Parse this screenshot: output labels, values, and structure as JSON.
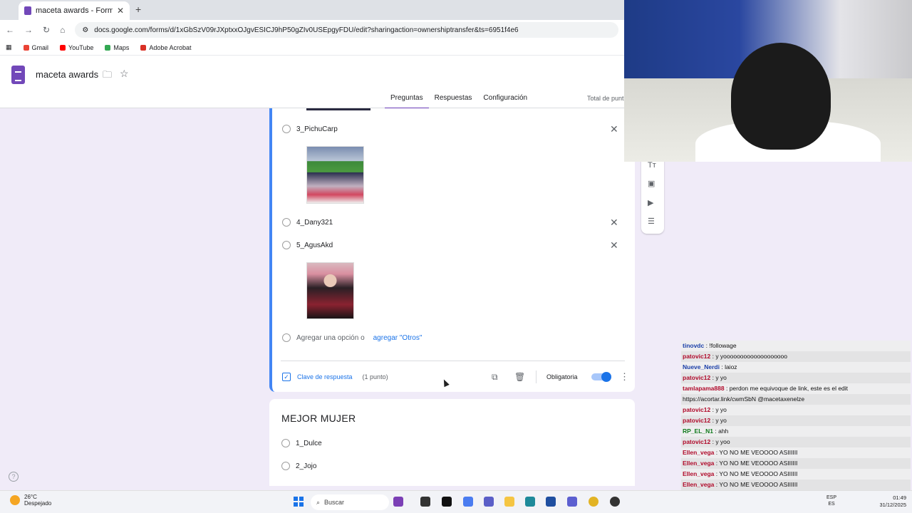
{
  "browser": {
    "tab_title": "maceta awards - Formularios d",
    "url": "docs.google.com/forms/d/1xGbSzV09rJXptxxOJgvESICJ9hP50gZIv0USEpgyFDU/edit?sharingaction=ownershiptransfer&ts=6951f4e6",
    "bookmarks": [
      {
        "label": "Gmail",
        "color": "#ea4335"
      },
      {
        "label": "YouTube",
        "color": "#ff0000"
      },
      {
        "label": "Maps",
        "color": "#34a853"
      },
      {
        "label": "Adobe Acrobat",
        "color": "#d93025"
      }
    ]
  },
  "forms": {
    "doc_title": "maceta awards",
    "tabs": [
      "Preguntas",
      "Respuestas",
      "Configuración"
    ],
    "total_label": "Total de punt"
  },
  "question1": {
    "options": [
      "3_PichuCarp",
      "4_Dany321",
      "5_AgusAkd"
    ],
    "add_option": "Agregar una opción o",
    "add_other": "agregar \"Otros\"",
    "answer_key": "Clave de respuesta",
    "points": "(1 punto)",
    "required_label": "Obligatoria",
    "required": true
  },
  "question2": {
    "title": "MEJOR MUJER",
    "options": [
      "1_Dulce",
      "2_Jojo"
    ]
  },
  "chat": [
    {
      "user": "tinovdc",
      "msg": "!followage",
      "color": "blue"
    },
    {
      "user": "patovic12",
      "msg": "y yooooooooooooooooooo",
      "color": "red"
    },
    {
      "user": "Nueve_Nerdi",
      "msg": "laioz",
      "color": "blue"
    },
    {
      "user": "patovic12",
      "msg": "y yo",
      "color": "red"
    },
    {
      "user": "tamlapama888",
      "msg": "perdon me equivoque de link, este es el edit",
      "color": "red"
    },
    {
      "user": "",
      "msg": "https://acortar.link/cwmSbN @macetaxenelze",
      "color": "red"
    },
    {
      "user": "patovic12",
      "msg": "y yo",
      "color": "red"
    },
    {
      "user": "patovic12",
      "msg": "y yo",
      "color": "red"
    },
    {
      "user": "RP_EL_N1",
      "msg": "ahh",
      "color": "green"
    },
    {
      "user": "patovic12",
      "msg": "y yoo",
      "color": "red"
    },
    {
      "user": "Ellen_vega",
      "msg": "YO NO ME VEOOOO ASIIIIII",
      "color": "red"
    },
    {
      "user": "Ellen_vega",
      "msg": "YO NO ME VEOOOO ASIIIIII",
      "color": "red"
    },
    {
      "user": "Ellen_vega",
      "msg": "YO NO ME VEOOOO ASIIIIII",
      "color": "red"
    },
    {
      "user": "Ellen_vega",
      "msg": "YO NO ME VEOOOO ASIIIIII",
      "color": "red"
    },
    {
      "user": "Ellen_vega",
      "msg": "YO NO ME VEOOOO ASIIIIII",
      "color": "red"
    }
  ],
  "taskbar": {
    "temp": "26°C",
    "weather": "Despejado",
    "search": "Buscar",
    "lang": "ESP",
    "lang2": "ES",
    "time": "01:49",
    "date": "31/12/2025"
  }
}
